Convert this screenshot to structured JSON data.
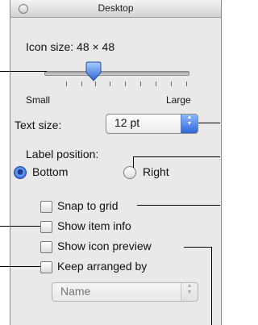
{
  "window": {
    "title": "Desktop"
  },
  "icon_size": {
    "label": "Icon size:",
    "value": "48 × 48",
    "slider_min_label": "Small",
    "slider_max_label": "Large",
    "slider_level": 0.25
  },
  "text_size": {
    "label": "Text size:",
    "selected": "12 pt"
  },
  "label_position": {
    "label": "Label position:",
    "options": [
      {
        "label": "Bottom",
        "selected": true
      },
      {
        "label": "Right",
        "selected": false
      }
    ]
  },
  "checkboxes": [
    {
      "label": "Snap to grid",
      "checked": false
    },
    {
      "label": "Show item info",
      "checked": false
    },
    {
      "label": "Show icon preview",
      "checked": false
    },
    {
      "label": "Keep arranged by",
      "checked": false
    }
  ],
  "arrange_by": {
    "selected": "Name",
    "enabled": false
  },
  "colors": {
    "accent": "#2f66d8",
    "panel": "#e9e9e9"
  }
}
